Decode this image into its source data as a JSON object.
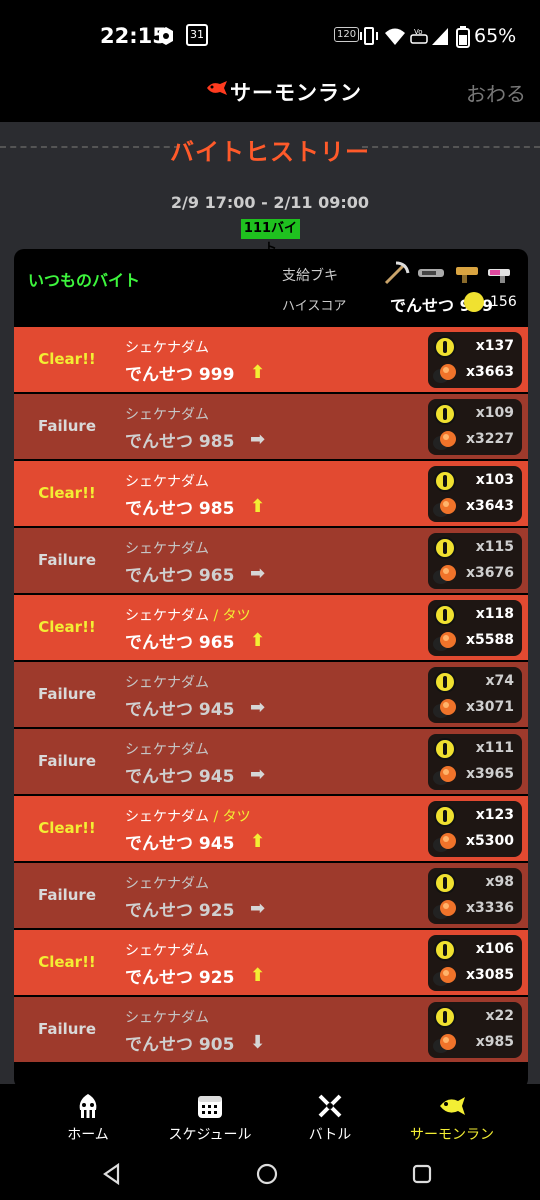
{
  "status_bar": {
    "time": "22:15",
    "calendar": "31",
    "refresh_rate": "120",
    "battery": "65%"
  },
  "header": {
    "title": "サーモンラン",
    "close": "おわる"
  },
  "section": {
    "title": "バイトヒストリー",
    "period": "2/9 17:00 - 2/11 09:00",
    "count": "111バイト"
  },
  "card": {
    "mode": "いつものバイト",
    "supply_label": "支給ブキ",
    "highscore_label": "ハイスコア",
    "highscore_rank": "でんせつ 999",
    "highscore_eggs": "156"
  },
  "jobs": [
    {
      "result": "Clear!!",
      "stage": "シェケナダム",
      "extra": "",
      "rank": "でんせつ 999",
      "arrow": "up",
      "golden": "x137",
      "power": "x3663"
    },
    {
      "result": "Failure",
      "stage": "シェケナダム",
      "extra": "",
      "rank": "でんせつ 985",
      "arrow": "right",
      "golden": "x109",
      "power": "x3227"
    },
    {
      "result": "Clear!!",
      "stage": "シェケナダム",
      "extra": "",
      "rank": "でんせつ 985",
      "arrow": "up",
      "golden": "x103",
      "power": "x3643"
    },
    {
      "result": "Failure",
      "stage": "シェケナダム",
      "extra": "",
      "rank": "でんせつ 965",
      "arrow": "right",
      "golden": "x115",
      "power": "x3676"
    },
    {
      "result": "Clear!!",
      "stage": "シェケナダム",
      "extra": "タツ",
      "rank": "でんせつ 965",
      "arrow": "up",
      "golden": "x118",
      "power": "x5588"
    },
    {
      "result": "Failure",
      "stage": "シェケナダム",
      "extra": "",
      "rank": "でんせつ 945",
      "arrow": "right",
      "golden": "x74",
      "power": "x3071"
    },
    {
      "result": "Failure",
      "stage": "シェケナダム",
      "extra": "",
      "rank": "でんせつ 945",
      "arrow": "right",
      "golden": "x111",
      "power": "x3965"
    },
    {
      "result": "Clear!!",
      "stage": "シェケナダム",
      "extra": "タツ",
      "rank": "でんせつ 945",
      "arrow": "up",
      "golden": "x123",
      "power": "x5300"
    },
    {
      "result": "Failure",
      "stage": "シェケナダム",
      "extra": "",
      "rank": "でんせつ 925",
      "arrow": "right",
      "golden": "x98",
      "power": "x3336"
    },
    {
      "result": "Clear!!",
      "stage": "シェケナダム",
      "extra": "",
      "rank": "でんせつ 925",
      "arrow": "up",
      "golden": "x106",
      "power": "x3085"
    },
    {
      "result": "Failure",
      "stage": "シェケナダム",
      "extra": "",
      "rank": "でんせつ 905",
      "arrow": "down",
      "golden": "x22",
      "power": "x985"
    }
  ],
  "nav": [
    {
      "label": "ホーム",
      "icon": "squid-icon",
      "active": false
    },
    {
      "label": "スケジュール",
      "icon": "calendar-icon",
      "active": false
    },
    {
      "label": "バトル",
      "icon": "crossed-weapons-icon",
      "active": false
    },
    {
      "label": "サーモンラン",
      "icon": "salmon-icon",
      "active": true
    }
  ],
  "colors": {
    "clear_row": "#e24a31",
    "failure_row": "#9e3a2c",
    "accent_yellow": "#f3ee34",
    "accent_green": "#3df53d",
    "title_orange": "#ff5a2a"
  }
}
